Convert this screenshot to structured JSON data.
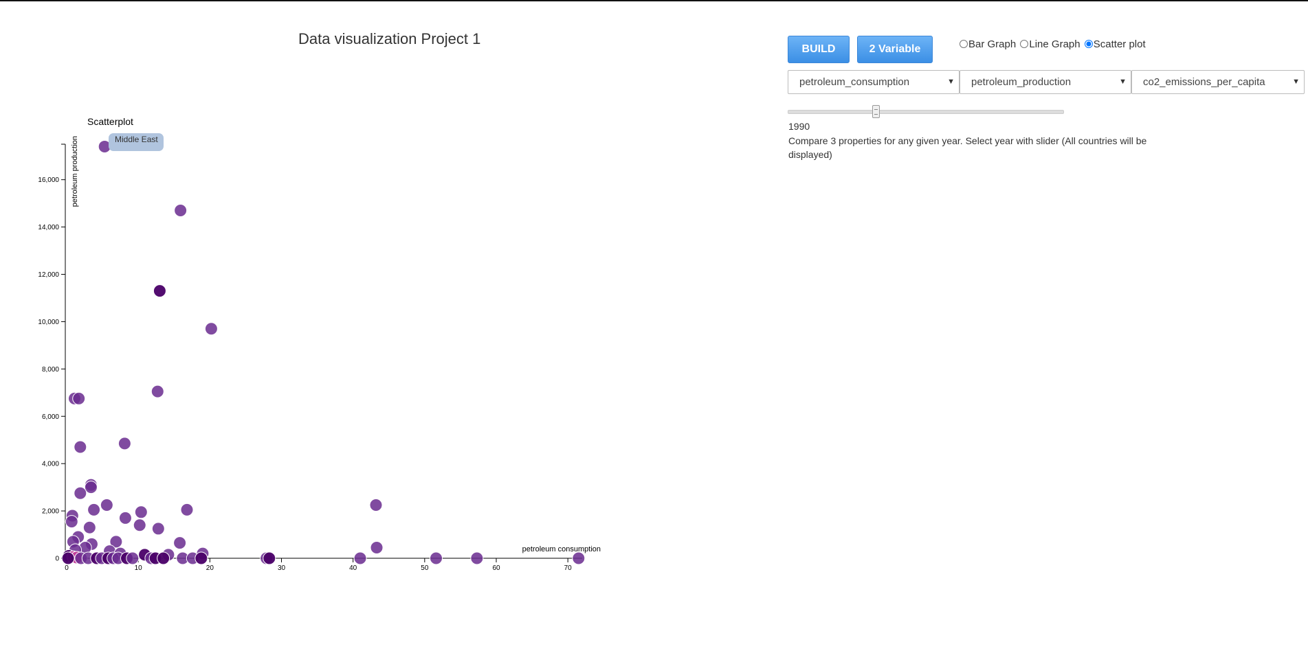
{
  "page": {
    "title": "Data visualization Project 1"
  },
  "controls": {
    "build_label": "BUILD",
    "two_var_label": "2 Variable",
    "radios": [
      {
        "label": "Bar Graph",
        "checked": false
      },
      {
        "label": "Line Graph",
        "checked": false
      },
      {
        "label": "Scatter plot",
        "checked": true
      }
    ],
    "selects": [
      {
        "value": "petroleum_consumption"
      },
      {
        "value": "petroleum_production"
      },
      {
        "value": "co2_emissions_per_capita"
      }
    ],
    "slider": {
      "year": "1990",
      "fraction": 0.32
    },
    "description": "Compare 3 properties for any given year. Select year with slider (All countries will be displayed)"
  },
  "tooltip": {
    "text": "Middle East"
  },
  "colors": {
    "point": "#6a2c8f",
    "point_dark": "#4a0068",
    "point_pink": "#c23d9a",
    "button": "#3b8fe5"
  },
  "chart_data": {
    "type": "scatter",
    "title": "Scatterplot",
    "xlabel": "petroleum consumption",
    "ylabel": "petroleum production",
    "xlim": [
      0,
      72
    ],
    "ylim": [
      0,
      17500
    ],
    "xticks": [
      0,
      10,
      20,
      30,
      40,
      50,
      60,
      70
    ],
    "yticks": [
      0,
      2000,
      4000,
      6000,
      8000,
      10000,
      12000,
      14000,
      16000
    ],
    "xtick_labels": [
      "0",
      "10",
      "20",
      "30",
      "40",
      "50",
      "60",
      "70"
    ],
    "ytick_labels": [
      "0",
      "2,000",
      "4,000",
      "6,000",
      "8,000",
      "10,000",
      "12,000",
      "14,000",
      "16,000"
    ],
    "points": [
      {
        "x": 5.3,
        "y": 17400,
        "shade": 1
      },
      {
        "x": 15.9,
        "y": 14700,
        "shade": 1
      },
      {
        "x": 13.0,
        "y": 11300,
        "shade": 2
      },
      {
        "x": 20.2,
        "y": 9700,
        "shade": 1
      },
      {
        "x": 12.7,
        "y": 7050,
        "shade": 1
      },
      {
        "x": 1.1,
        "y": 6750,
        "shade": 1
      },
      {
        "x": 1.7,
        "y": 6750,
        "shade": 1
      },
      {
        "x": 8.1,
        "y": 4850,
        "shade": 1
      },
      {
        "x": 1.9,
        "y": 4700,
        "shade": 1
      },
      {
        "x": 3.4,
        "y": 3100,
        "shade": 1
      },
      {
        "x": 3.4,
        "y": 3000,
        "shade": 1
      },
      {
        "x": 1.9,
        "y": 2750,
        "shade": 1
      },
      {
        "x": 43.2,
        "y": 2250,
        "shade": 1
      },
      {
        "x": 5.6,
        "y": 2250,
        "shade": 1
      },
      {
        "x": 3.8,
        "y": 2050,
        "shade": 1
      },
      {
        "x": 16.8,
        "y": 2050,
        "shade": 1
      },
      {
        "x": 10.4,
        "y": 1950,
        "shade": 1
      },
      {
        "x": 0.8,
        "y": 1800,
        "shade": 1
      },
      {
        "x": 8.2,
        "y": 1700,
        "shade": 1
      },
      {
        "x": 0.7,
        "y": 1550,
        "shade": 1
      },
      {
        "x": 10.2,
        "y": 1400,
        "shade": 1
      },
      {
        "x": 3.2,
        "y": 1300,
        "shade": 1
      },
      {
        "x": 12.8,
        "y": 1250,
        "shade": 1
      },
      {
        "x": 1.6,
        "y": 900,
        "shade": 1
      },
      {
        "x": 0.9,
        "y": 700,
        "shade": 1
      },
      {
        "x": 6.9,
        "y": 700,
        "shade": 1
      },
      {
        "x": 15.8,
        "y": 650,
        "shade": 1
      },
      {
        "x": 3.5,
        "y": 600,
        "shade": 1
      },
      {
        "x": 2.6,
        "y": 450,
        "shade": 1
      },
      {
        "x": 43.3,
        "y": 450,
        "shade": 1
      },
      {
        "x": 1.2,
        "y": 350,
        "shade": 1
      },
      {
        "x": 6.0,
        "y": 300,
        "shade": 1
      },
      {
        "x": 19.0,
        "y": 200,
        "shade": 1
      },
      {
        "x": 7.5,
        "y": 200,
        "shade": 1
      },
      {
        "x": 14.2,
        "y": 150,
        "shade": 1
      },
      {
        "x": 10.9,
        "y": 150,
        "shade": 2
      },
      {
        "x": 0.3,
        "y": 100,
        "shade": 2
      },
      {
        "x": 0.9,
        "y": 50,
        "shade": 0
      },
      {
        "x": 1.4,
        "y": 30,
        "shade": 0
      },
      {
        "x": 0.2,
        "y": 0,
        "shade": 2
      },
      {
        "x": 2.0,
        "y": 0,
        "shade": 1
      },
      {
        "x": 3.0,
        "y": 0,
        "shade": 1
      },
      {
        "x": 4.2,
        "y": 0,
        "shade": 2
      },
      {
        "x": 4.9,
        "y": 0,
        "shade": 1
      },
      {
        "x": 5.8,
        "y": 0,
        "shade": 2
      },
      {
        "x": 6.5,
        "y": 0,
        "shade": 1
      },
      {
        "x": 7.2,
        "y": 0,
        "shade": 1
      },
      {
        "x": 8.4,
        "y": 0,
        "shade": 2
      },
      {
        "x": 9.2,
        "y": 0,
        "shade": 1
      },
      {
        "x": 11.8,
        "y": 0,
        "shade": 1
      },
      {
        "x": 12.4,
        "y": 0,
        "shade": 2
      },
      {
        "x": 13.5,
        "y": 0,
        "shade": 2
      },
      {
        "x": 16.2,
        "y": 0,
        "shade": 1
      },
      {
        "x": 17.6,
        "y": 0,
        "shade": 1
      },
      {
        "x": 18.8,
        "y": 0,
        "shade": 2
      },
      {
        "x": 27.9,
        "y": 0,
        "shade": 1
      },
      {
        "x": 28.3,
        "y": 0,
        "shade": 2
      },
      {
        "x": 41.0,
        "y": 0,
        "shade": 1
      },
      {
        "x": 51.6,
        "y": 0,
        "shade": 1
      },
      {
        "x": 57.3,
        "y": 0,
        "shade": 1
      },
      {
        "x": 71.5,
        "y": 0,
        "shade": 1
      }
    ]
  }
}
